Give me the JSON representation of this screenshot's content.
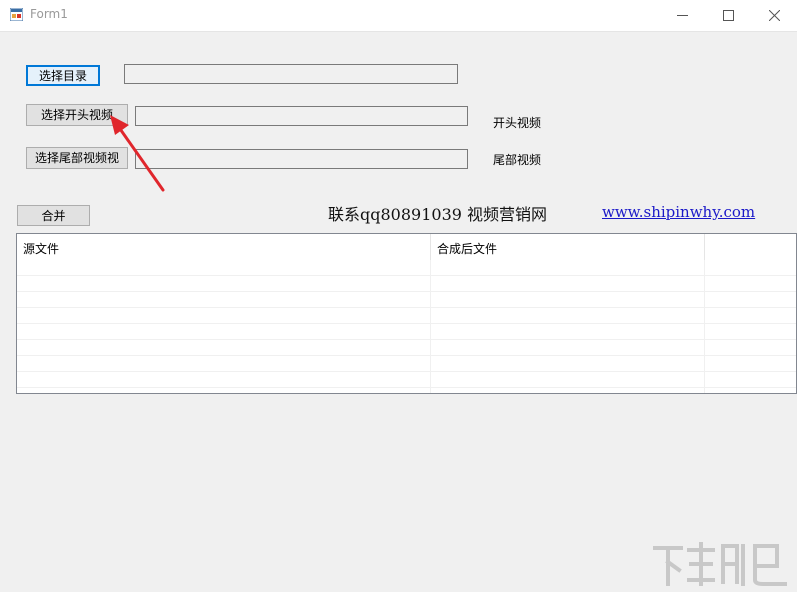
{
  "window": {
    "title": "Form1"
  },
  "buttons": {
    "select_dir": "选择目录",
    "select_intro": "选择开头视频",
    "select_outro": "选择尾部视频视",
    "merge": "合并"
  },
  "labels": {
    "intro_video": "开头视频",
    "outro_video": "尾部视频"
  },
  "inputs": {
    "dir_path": "",
    "intro_path": "",
    "outro_path": ""
  },
  "contact": {
    "text": "联系qq80891039   视频营销网",
    "link": "www.shipinwhy.com"
  },
  "list": {
    "columns": [
      "源文件",
      "合成后文件"
    ],
    "rows": []
  },
  "colors": {
    "link": "#1a18c8",
    "focus_border": "#0078d7",
    "arrow": "#e0262c"
  }
}
